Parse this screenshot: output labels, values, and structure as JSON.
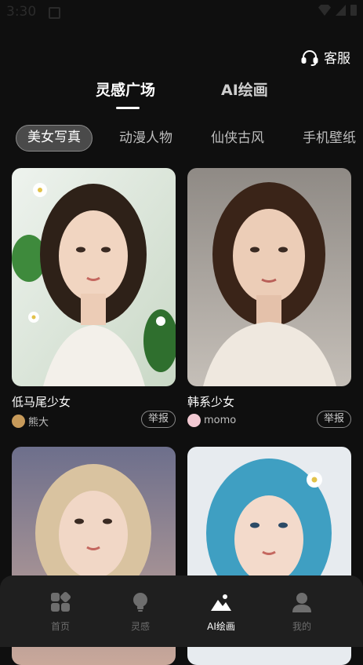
{
  "status_bar": {
    "time": "3:30"
  },
  "header": {
    "service_label": "客服"
  },
  "top_tabs": [
    {
      "label": "灵感广场",
      "active": true
    },
    {
      "label": "AI绘画",
      "active": false
    }
  ],
  "categories": [
    {
      "label": "美女写真",
      "active": true
    },
    {
      "label": "动漫人物",
      "active": false
    },
    {
      "label": "仙侠古风",
      "active": false
    },
    {
      "label": "手机壁纸",
      "active": false
    }
  ],
  "cards": [
    {
      "title": "低马尾少女",
      "author": "熊大",
      "report_label": "举报"
    },
    {
      "title": "韩系少女",
      "author": "momo",
      "report_label": "举报"
    },
    {
      "title": "",
      "author": "",
      "report_label": ""
    },
    {
      "title": "",
      "author": "",
      "report_label": ""
    }
  ],
  "bottom_nav": [
    {
      "label": "首页",
      "icon": "grid-icon",
      "active": false
    },
    {
      "label": "灵感",
      "icon": "bulb-icon",
      "active": false
    },
    {
      "label": "AI绘画",
      "icon": "image-icon",
      "active": true
    },
    {
      "label": "我的",
      "icon": "user-icon",
      "active": false
    }
  ],
  "colors": {
    "background": "#0f0f0f",
    "nav_background": "#1f1f1f",
    "active_text": "#ffffff",
    "inactive_text": "#6e6e6e"
  }
}
